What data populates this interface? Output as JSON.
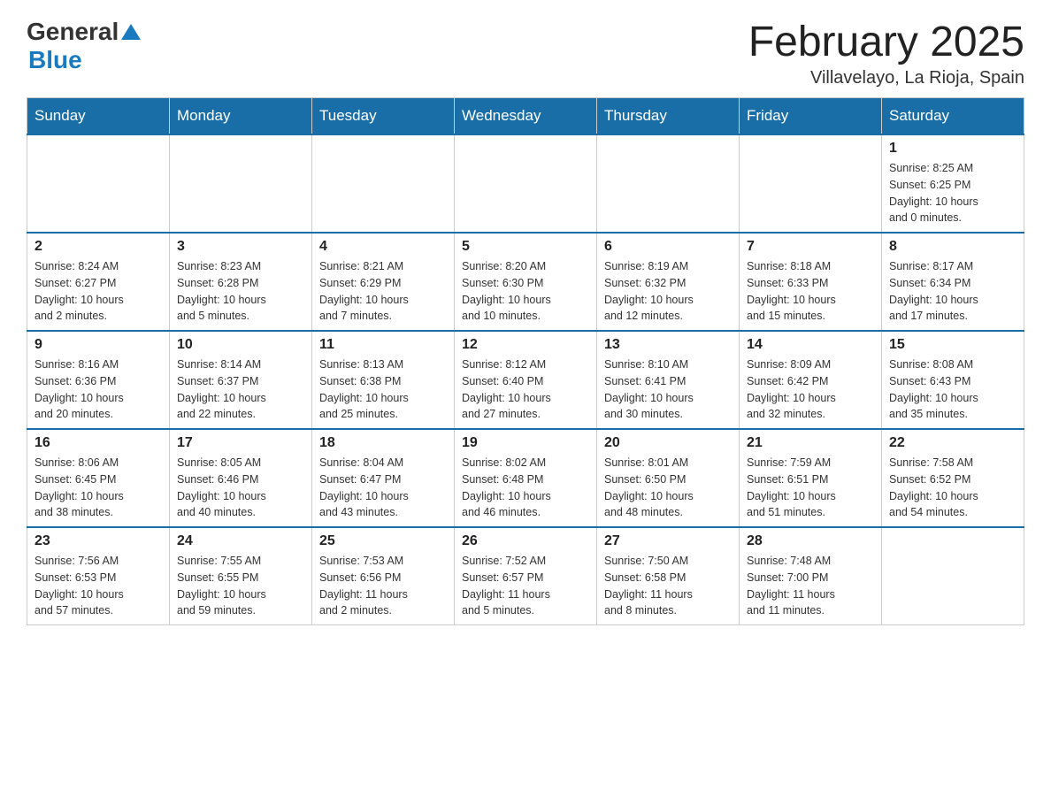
{
  "header": {
    "logo": {
      "general": "General",
      "blue": "Blue"
    },
    "title": "February 2025",
    "location": "Villavelayo, La Rioja, Spain"
  },
  "weekdays": [
    "Sunday",
    "Monday",
    "Tuesday",
    "Wednesday",
    "Thursday",
    "Friday",
    "Saturday"
  ],
  "weeks": [
    [
      {
        "day": "",
        "info": ""
      },
      {
        "day": "",
        "info": ""
      },
      {
        "day": "",
        "info": ""
      },
      {
        "day": "",
        "info": ""
      },
      {
        "day": "",
        "info": ""
      },
      {
        "day": "",
        "info": ""
      },
      {
        "day": "1",
        "info": "Sunrise: 8:25 AM\nSunset: 6:25 PM\nDaylight: 10 hours\nand 0 minutes."
      }
    ],
    [
      {
        "day": "2",
        "info": "Sunrise: 8:24 AM\nSunset: 6:27 PM\nDaylight: 10 hours\nand 2 minutes."
      },
      {
        "day": "3",
        "info": "Sunrise: 8:23 AM\nSunset: 6:28 PM\nDaylight: 10 hours\nand 5 minutes."
      },
      {
        "day": "4",
        "info": "Sunrise: 8:21 AM\nSunset: 6:29 PM\nDaylight: 10 hours\nand 7 minutes."
      },
      {
        "day": "5",
        "info": "Sunrise: 8:20 AM\nSunset: 6:30 PM\nDaylight: 10 hours\nand 10 minutes."
      },
      {
        "day": "6",
        "info": "Sunrise: 8:19 AM\nSunset: 6:32 PM\nDaylight: 10 hours\nand 12 minutes."
      },
      {
        "day": "7",
        "info": "Sunrise: 8:18 AM\nSunset: 6:33 PM\nDaylight: 10 hours\nand 15 minutes."
      },
      {
        "day": "8",
        "info": "Sunrise: 8:17 AM\nSunset: 6:34 PM\nDaylight: 10 hours\nand 17 minutes."
      }
    ],
    [
      {
        "day": "9",
        "info": "Sunrise: 8:16 AM\nSunset: 6:36 PM\nDaylight: 10 hours\nand 20 minutes."
      },
      {
        "day": "10",
        "info": "Sunrise: 8:14 AM\nSunset: 6:37 PM\nDaylight: 10 hours\nand 22 minutes."
      },
      {
        "day": "11",
        "info": "Sunrise: 8:13 AM\nSunset: 6:38 PM\nDaylight: 10 hours\nand 25 minutes."
      },
      {
        "day": "12",
        "info": "Sunrise: 8:12 AM\nSunset: 6:40 PM\nDaylight: 10 hours\nand 27 minutes."
      },
      {
        "day": "13",
        "info": "Sunrise: 8:10 AM\nSunset: 6:41 PM\nDaylight: 10 hours\nand 30 minutes."
      },
      {
        "day": "14",
        "info": "Sunrise: 8:09 AM\nSunset: 6:42 PM\nDaylight: 10 hours\nand 32 minutes."
      },
      {
        "day": "15",
        "info": "Sunrise: 8:08 AM\nSunset: 6:43 PM\nDaylight: 10 hours\nand 35 minutes."
      }
    ],
    [
      {
        "day": "16",
        "info": "Sunrise: 8:06 AM\nSunset: 6:45 PM\nDaylight: 10 hours\nand 38 minutes."
      },
      {
        "day": "17",
        "info": "Sunrise: 8:05 AM\nSunset: 6:46 PM\nDaylight: 10 hours\nand 40 minutes."
      },
      {
        "day": "18",
        "info": "Sunrise: 8:04 AM\nSunset: 6:47 PM\nDaylight: 10 hours\nand 43 minutes."
      },
      {
        "day": "19",
        "info": "Sunrise: 8:02 AM\nSunset: 6:48 PM\nDaylight: 10 hours\nand 46 minutes."
      },
      {
        "day": "20",
        "info": "Sunrise: 8:01 AM\nSunset: 6:50 PM\nDaylight: 10 hours\nand 48 minutes."
      },
      {
        "day": "21",
        "info": "Sunrise: 7:59 AM\nSunset: 6:51 PM\nDaylight: 10 hours\nand 51 minutes."
      },
      {
        "day": "22",
        "info": "Sunrise: 7:58 AM\nSunset: 6:52 PM\nDaylight: 10 hours\nand 54 minutes."
      }
    ],
    [
      {
        "day": "23",
        "info": "Sunrise: 7:56 AM\nSunset: 6:53 PM\nDaylight: 10 hours\nand 57 minutes."
      },
      {
        "day": "24",
        "info": "Sunrise: 7:55 AM\nSunset: 6:55 PM\nDaylight: 10 hours\nand 59 minutes."
      },
      {
        "day": "25",
        "info": "Sunrise: 7:53 AM\nSunset: 6:56 PM\nDaylight: 11 hours\nand 2 minutes."
      },
      {
        "day": "26",
        "info": "Sunrise: 7:52 AM\nSunset: 6:57 PM\nDaylight: 11 hours\nand 5 minutes."
      },
      {
        "day": "27",
        "info": "Sunrise: 7:50 AM\nSunset: 6:58 PM\nDaylight: 11 hours\nand 8 minutes."
      },
      {
        "day": "28",
        "info": "Sunrise: 7:48 AM\nSunset: 7:00 PM\nDaylight: 11 hours\nand 11 minutes."
      },
      {
        "day": "",
        "info": ""
      }
    ]
  ]
}
